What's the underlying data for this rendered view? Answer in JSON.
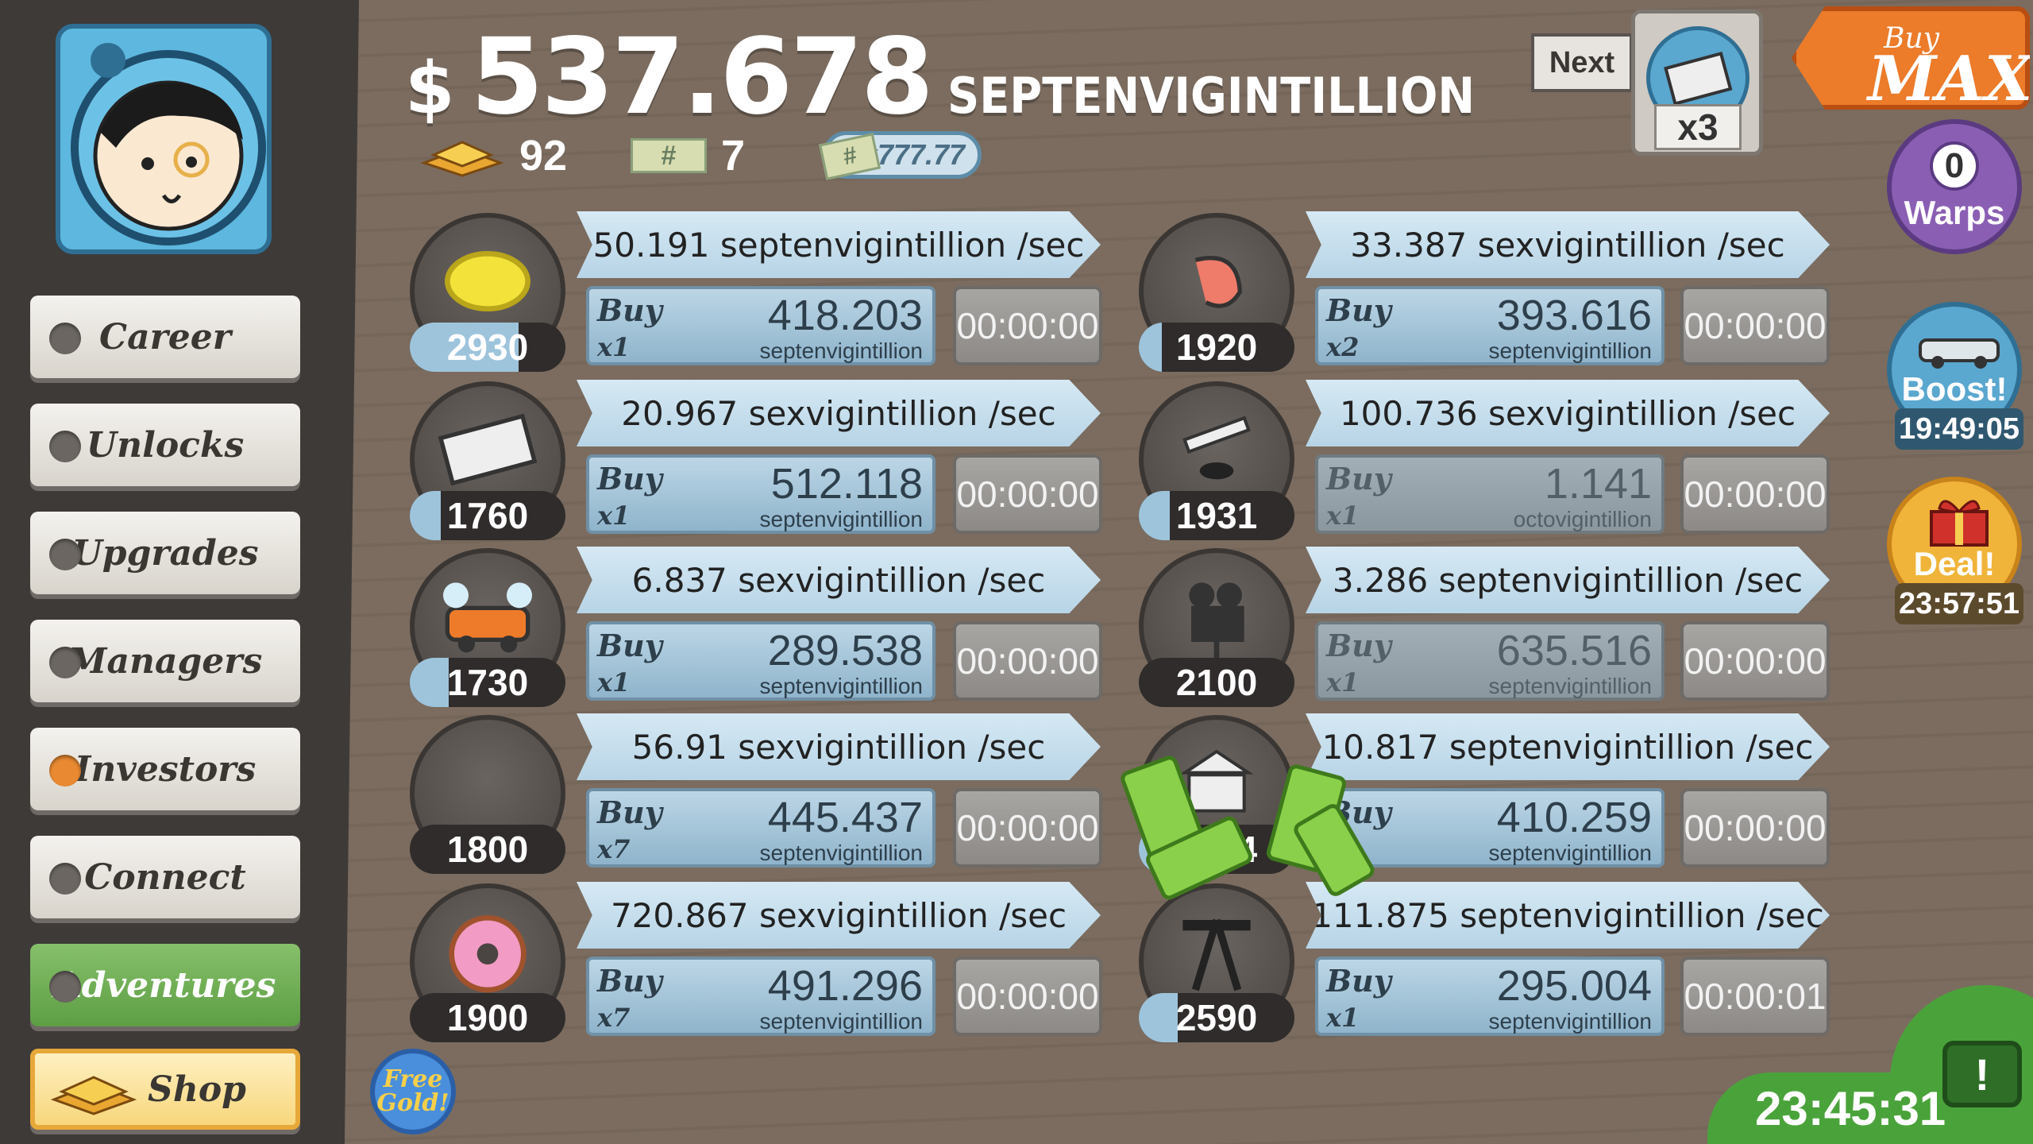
{
  "header": {
    "dollar_sign": "$",
    "money_amount": "537.678",
    "money_unit": "SEPTENVIGINTILLION",
    "gold_count": "92",
    "tickets_count": "7",
    "ticket_glyph": "#",
    "multiplier_label": "x777.77"
  },
  "sidebar": {
    "items": [
      {
        "label": "Career",
        "dot": "gray"
      },
      {
        "label": "Unlocks",
        "dot": "gray"
      },
      {
        "label": "Upgrades",
        "dot": "gray"
      },
      {
        "label": "Managers",
        "dot": "gray"
      },
      {
        "label": "Investors",
        "dot": "orange"
      },
      {
        "label": "Connect",
        "dot": "gray"
      },
      {
        "label": "Adventures",
        "dot": "gray"
      }
    ],
    "shop_label": "Shop",
    "free_gold_label": "Free Gold!"
  },
  "businesses_left": [
    {
      "icon": "lemon-icon",
      "count": "2930",
      "progress": 0.7,
      "rate": "50.191 septenvigintillion /sec",
      "buy_label": "Buy",
      "buy_mult": "x1",
      "buy_value": "418.203",
      "buy_unit": "septenvigintillion",
      "timer": "00:00:00"
    },
    {
      "icon": "newspaper-icon",
      "count": "1760",
      "progress": 0.2,
      "rate": "20.967 sexvigintillion /sec",
      "buy_label": "Buy",
      "buy_mult": "x1",
      "buy_value": "512.118",
      "buy_unit": "septenvigintillion",
      "timer": "00:00:00"
    },
    {
      "icon": "car-wash-icon",
      "count": "1730",
      "progress": 0.25,
      "rate": "6.837 sexvigintillion /sec",
      "buy_label": "Buy",
      "buy_mult": "x1",
      "buy_value": "289.538",
      "buy_unit": "septenvigintillion",
      "timer": "00:00:00"
    },
    {
      "icon": "pizza-icon",
      "count": "1800",
      "progress": 0,
      "rate": "56.91 sexvigintillion /sec",
      "buy_label": "Buy",
      "buy_mult": "x7",
      "buy_value": "445.437",
      "buy_unit": "septenvigintillion",
      "timer": "00:00:00"
    },
    {
      "icon": "donut-icon",
      "count": "1900",
      "progress": 0,
      "rate": "720.867 sexvigintillion /sec",
      "buy_label": "Buy",
      "buy_mult": "x7",
      "buy_value": "491.296",
      "buy_unit": "septenvigintillion",
      "timer": "00:00:00"
    }
  ],
  "businesses_right": [
    {
      "icon": "shrimp-icon",
      "count": "1920",
      "progress": 0.15,
      "rate": "33.387 sexvigintillion /sec",
      "buy_label": "Buy",
      "buy_mult": "x2",
      "buy_value": "393.616",
      "buy_unit": "septenvigintillion",
      "timer": "00:00:00",
      "dim": false
    },
    {
      "icon": "hockey-icon",
      "count": "1931",
      "progress": 0.2,
      "rate": "100.736 sexvigintillion /sec",
      "buy_label": "Buy",
      "buy_mult": "x1",
      "buy_value": "1.141",
      "buy_unit": "octovigintillion",
      "timer": "00:00:00",
      "dim": true
    },
    {
      "icon": "movie-camera-icon",
      "count": "2100",
      "progress": 0,
      "rate": "3.286 septenvigintillion /sec",
      "buy_label": "Buy",
      "buy_mult": "x1",
      "buy_value": "635.516",
      "buy_unit": "septenvigintillion",
      "timer": "00:00:00",
      "dim": true
    },
    {
      "icon": "bank-icon",
      "count": "2104",
      "progress": 0.1,
      "rate": "10.817 septenvigintillion /sec",
      "buy_label": "Buy",
      "buy_mult": "x2",
      "buy_value": "410.259",
      "buy_unit": "septenvigintillion",
      "timer": "00:00:00",
      "dim": false
    },
    {
      "icon": "oil-rig-icon",
      "count": "2590",
      "progress": 0.25,
      "rate": "111.875 septenvigintillion /sec",
      "buy_label": "Buy",
      "buy_mult": "x1",
      "buy_value": "295.004",
      "buy_unit": "septenvigintillion",
      "timer": "00:00:01",
      "dim": false
    }
  ],
  "top_right": {
    "next_label": "Next",
    "news_multiplier": "x3",
    "buy_max_top": "Buy",
    "buy_max_bottom": "MAX",
    "warps_count": "0",
    "warps_label": "Warps",
    "boost_label": "Boost!",
    "boost_timer": "19:49:05",
    "deal_label": "Deal!",
    "deal_timer": "23:57:51"
  },
  "footer": {
    "tv_timer": "23:45:31",
    "tv_icon_glyph": "!"
  },
  "colors": {
    "background": "#7a6b5e",
    "sidebar": "#3e3a38",
    "rate_bar": "#c7dfee",
    "buy_button": "#a6c6da",
    "accent_orange": "#ec7b2a",
    "accent_green": "#4aa33a",
    "warps_purple": "#8a5fb3"
  }
}
